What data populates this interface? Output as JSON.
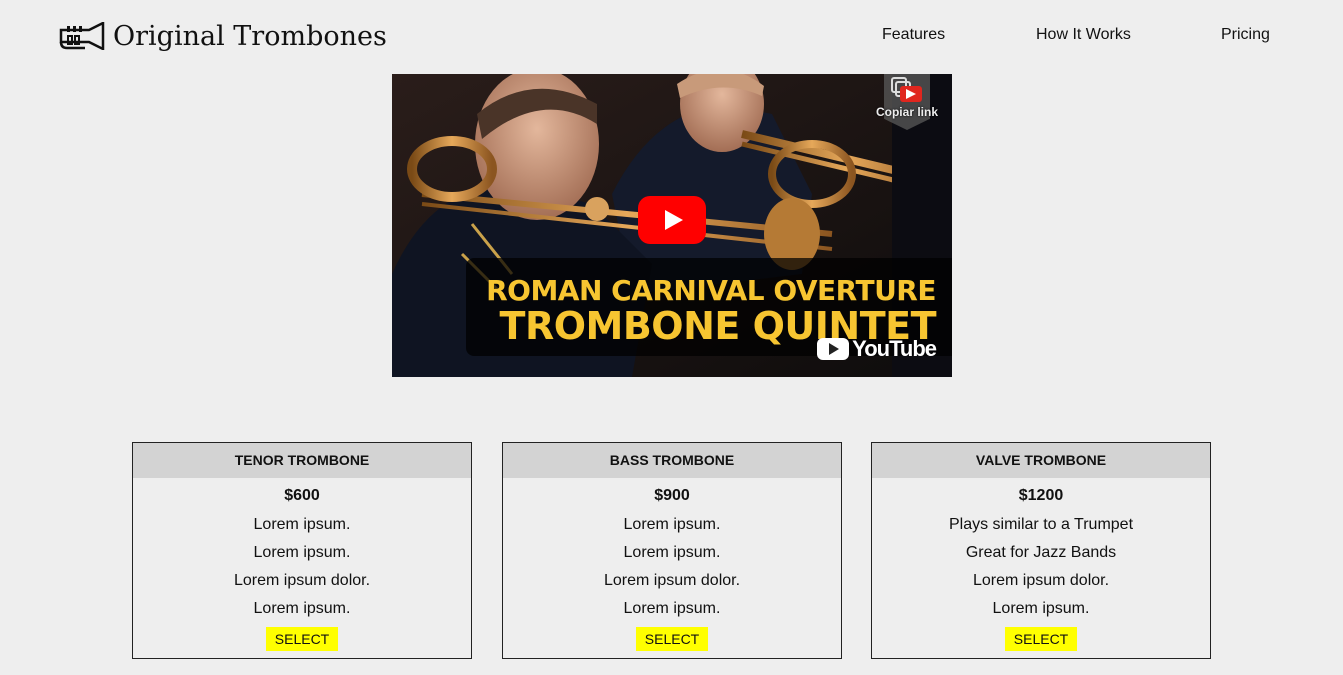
{
  "header": {
    "logo_text": "Original Trombones",
    "nav": {
      "features": "Features",
      "how_it_works": "How It Works",
      "pricing": "Pricing"
    }
  },
  "video": {
    "copy_link_label": "Copiar link",
    "title_line_1": "ROMAN CARNIVAL OVERTURE",
    "title_line_2": "TROMBONE QUINTET",
    "brand": "YouTube",
    "accent": "#f7c531",
    "play_color": "#ff0000"
  },
  "products": [
    {
      "name": "TENOR TROMBONE",
      "price": "$600",
      "features": [
        "Lorem ipsum.",
        "Lorem ipsum.",
        "Lorem ipsum dolor.",
        "Lorem ipsum."
      ],
      "button": "SELECT"
    },
    {
      "name": "BASS TROMBONE",
      "price": "$900",
      "features": [
        "Lorem ipsum.",
        "Lorem ipsum.",
        "Lorem ipsum dolor.",
        "Lorem ipsum."
      ],
      "button": "SELECT"
    },
    {
      "name": "VALVE TROMBONE",
      "price": "$1200",
      "features": [
        "Plays similar to a Trumpet",
        "Great for Jazz Bands",
        "Lorem ipsum dolor.",
        "Lorem ipsum."
      ],
      "button": "SELECT"
    }
  ],
  "colors": {
    "background": "#eeeeee",
    "card_header": "#d3d3d3",
    "button": "#ffff00"
  }
}
